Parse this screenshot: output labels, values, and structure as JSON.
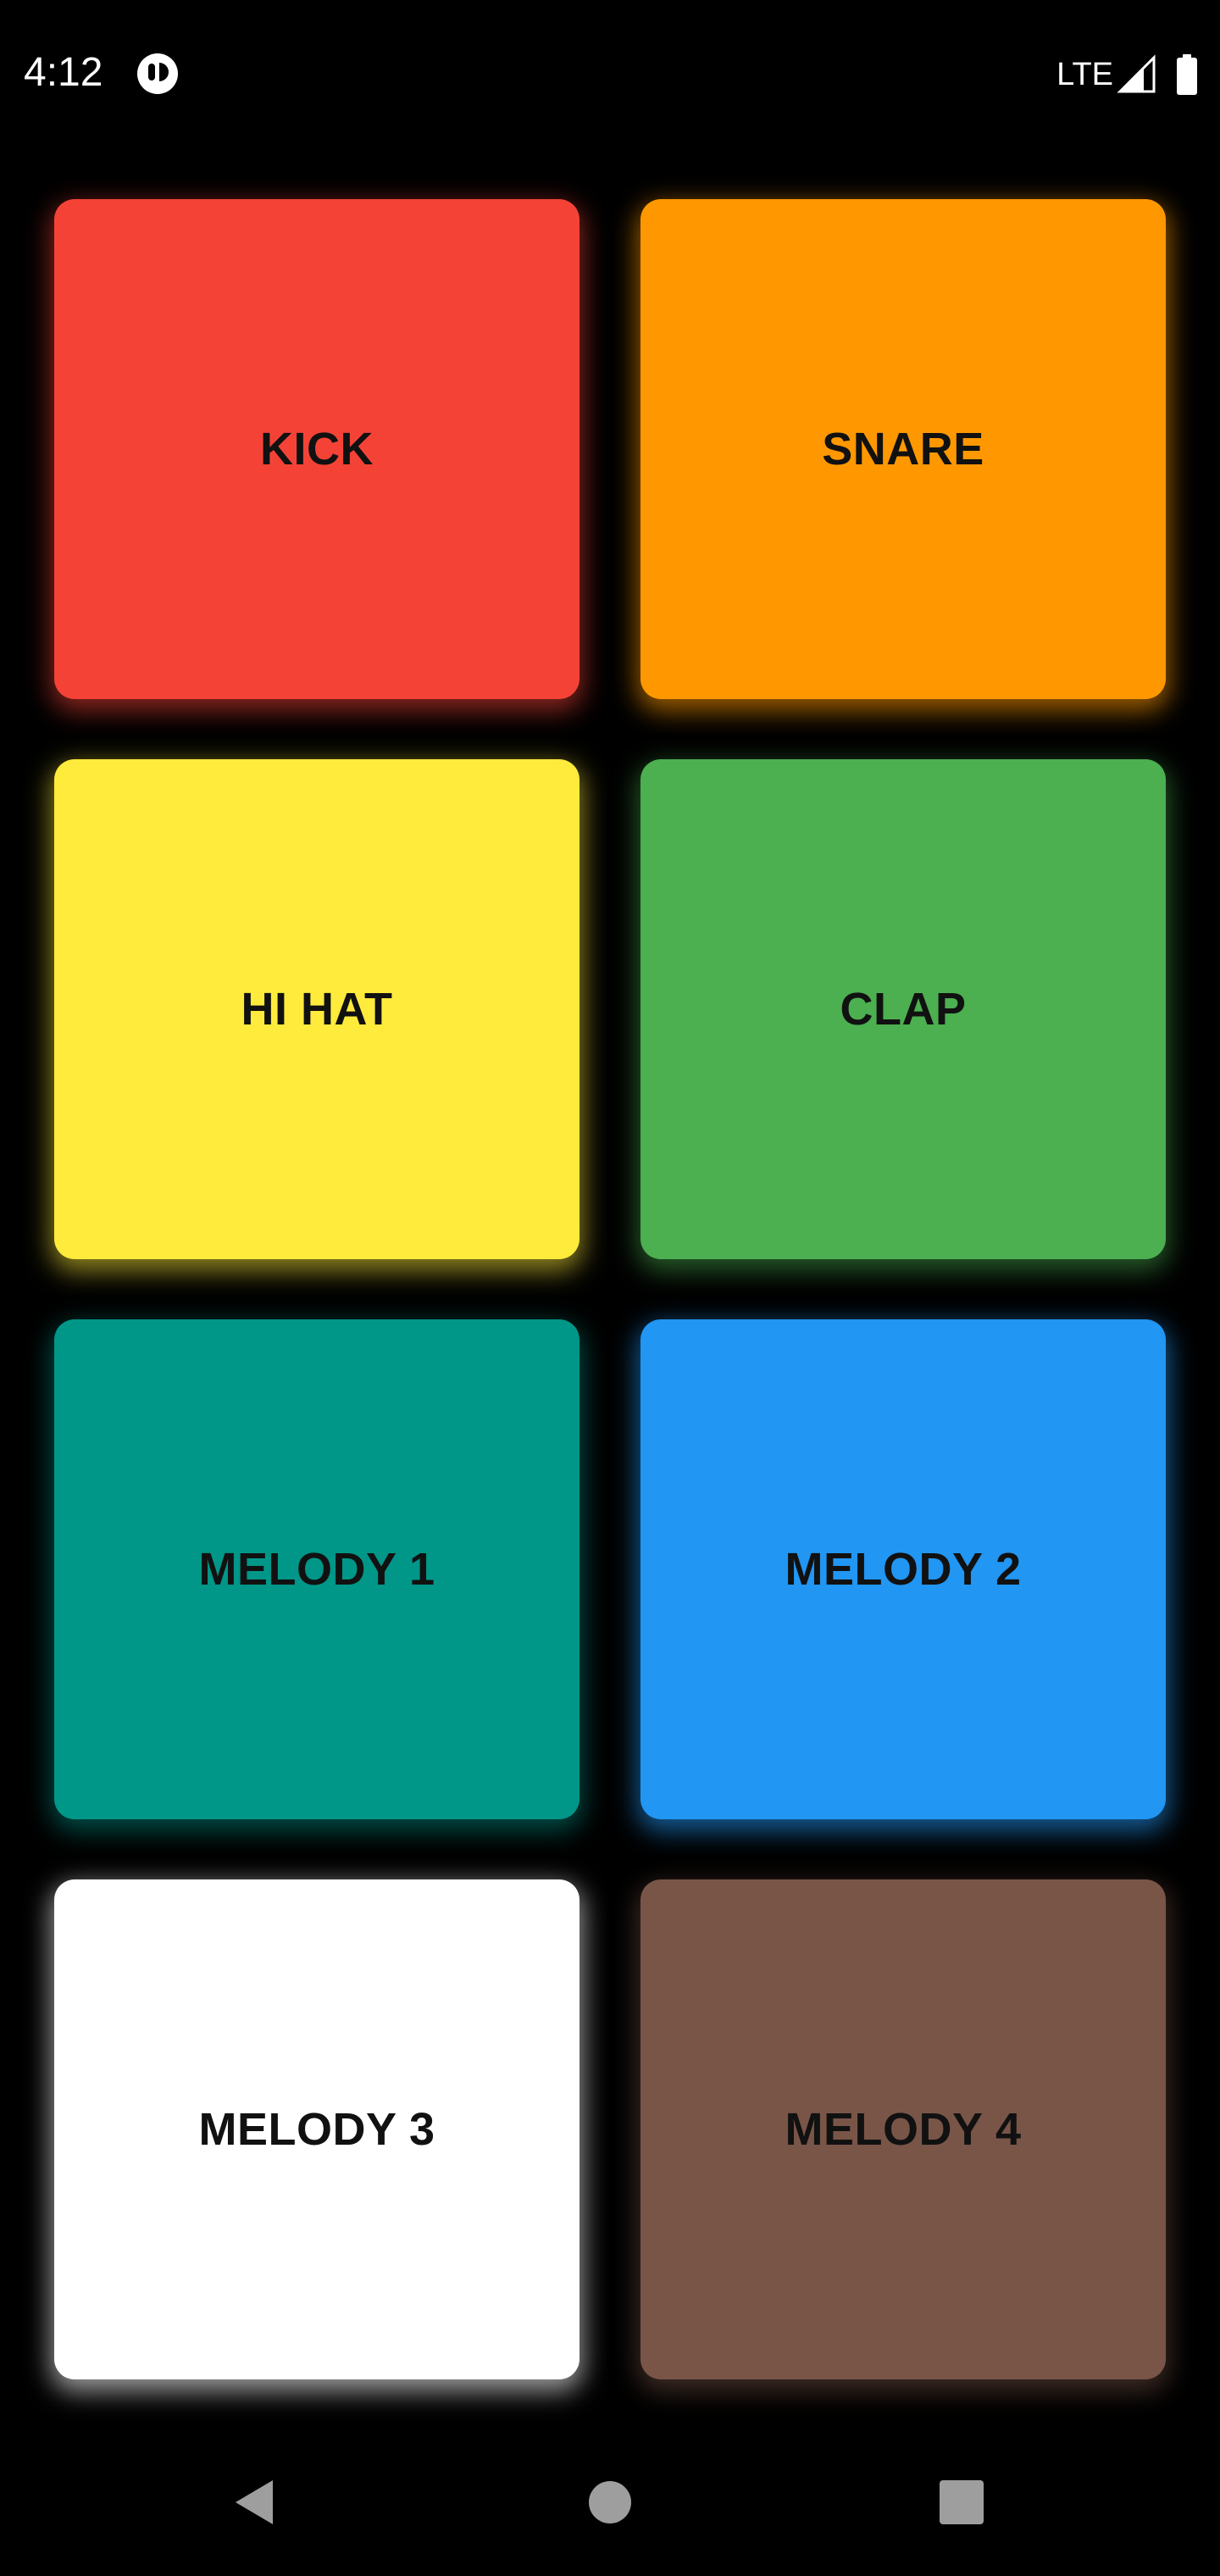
{
  "status_bar": {
    "time": "4:12",
    "network": "LTE",
    "icons": [
      "app-notification-icon",
      "signal-icon",
      "battery-icon"
    ]
  },
  "pads": [
    {
      "label": "KICK",
      "color": "#F44336",
      "glow": "rgba(244,67,54,0.55)"
    },
    {
      "label": "SNARE",
      "color": "#FF9800",
      "glow": "rgba(255,152,0,0.6)"
    },
    {
      "label": "HI HAT",
      "color": "#FFEB3B",
      "glow": "rgba(255,235,59,0.55)"
    },
    {
      "label": "CLAP",
      "color": "#4CAF50",
      "glow": "rgba(76,175,80,0.5)"
    },
    {
      "label": "MELODY 1",
      "color": "#009688",
      "glow": "rgba(0,150,136,0.5)"
    },
    {
      "label": "MELODY 2",
      "color": "#2196F3",
      "glow": "rgba(33,150,243,0.6)"
    },
    {
      "label": "MELODY 3",
      "color": "#FFFFFF",
      "glow": "rgba(255,255,255,0.6)"
    },
    {
      "label": "MELODY 4",
      "color": "#795548",
      "glow": "rgba(121,85,72,0.5)"
    }
  ],
  "nav_bar": {
    "icons": [
      "back-icon",
      "home-icon",
      "recents-icon"
    ],
    "icon_color": "#9E9E9E"
  }
}
